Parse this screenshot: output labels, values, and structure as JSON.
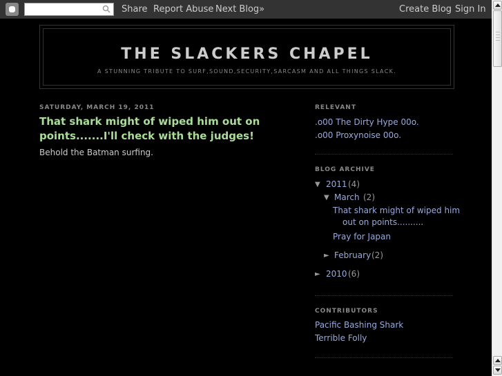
{
  "navbar": {
    "search_placeholder": "",
    "share": "Share",
    "report_abuse": "Report Abuse",
    "next_blog": "Next Blog»",
    "create_blog": "Create Blog",
    "sign_in": "Sign In"
  },
  "header": {
    "title": "THE SLACKERS CHAPEL",
    "description": "A STUNNING TRIBUTE TO SURF,SOUND,SECURITY,SARCASM AND ALL THINGS SLACK."
  },
  "post": {
    "date": "SATURDAY, MARCH 19, 2011",
    "title": "That shark might of wiped him out on points.......I'll check with the judges!",
    "body": "Behold the Batman surfing."
  },
  "sidebar": {
    "relevant": {
      "title": "RELEVANT",
      "links": [
        ".o00 The Dirty Hype 00o.",
        ".o00 Proxynoise 00o."
      ]
    },
    "archive": {
      "title": "BLOG ARCHIVE",
      "expanded_toggle": "▼",
      "collapsed_toggle": "►",
      "year_2011": {
        "label": "2011",
        "count": "(4)"
      },
      "march": {
        "label": "March",
        "count": "(2)"
      },
      "posts": [
        "That shark might of wiped him",
        "out on points..........",
        "Pray for Japan"
      ],
      "february": {
        "label": "February",
        "count": "(2)"
      },
      "year_2010": {
        "label": "2010",
        "count": "(6)"
      }
    },
    "contributors": {
      "title": "CONTRIBUTORS",
      "names": [
        "Pacific Bashing Shark",
        "Terrible Folly"
      ]
    }
  },
  "colors": {
    "background": "#000000",
    "navbar": "#333333",
    "post_title": "#aadd99",
    "link": "#99aadd",
    "muted": "#888888"
  }
}
